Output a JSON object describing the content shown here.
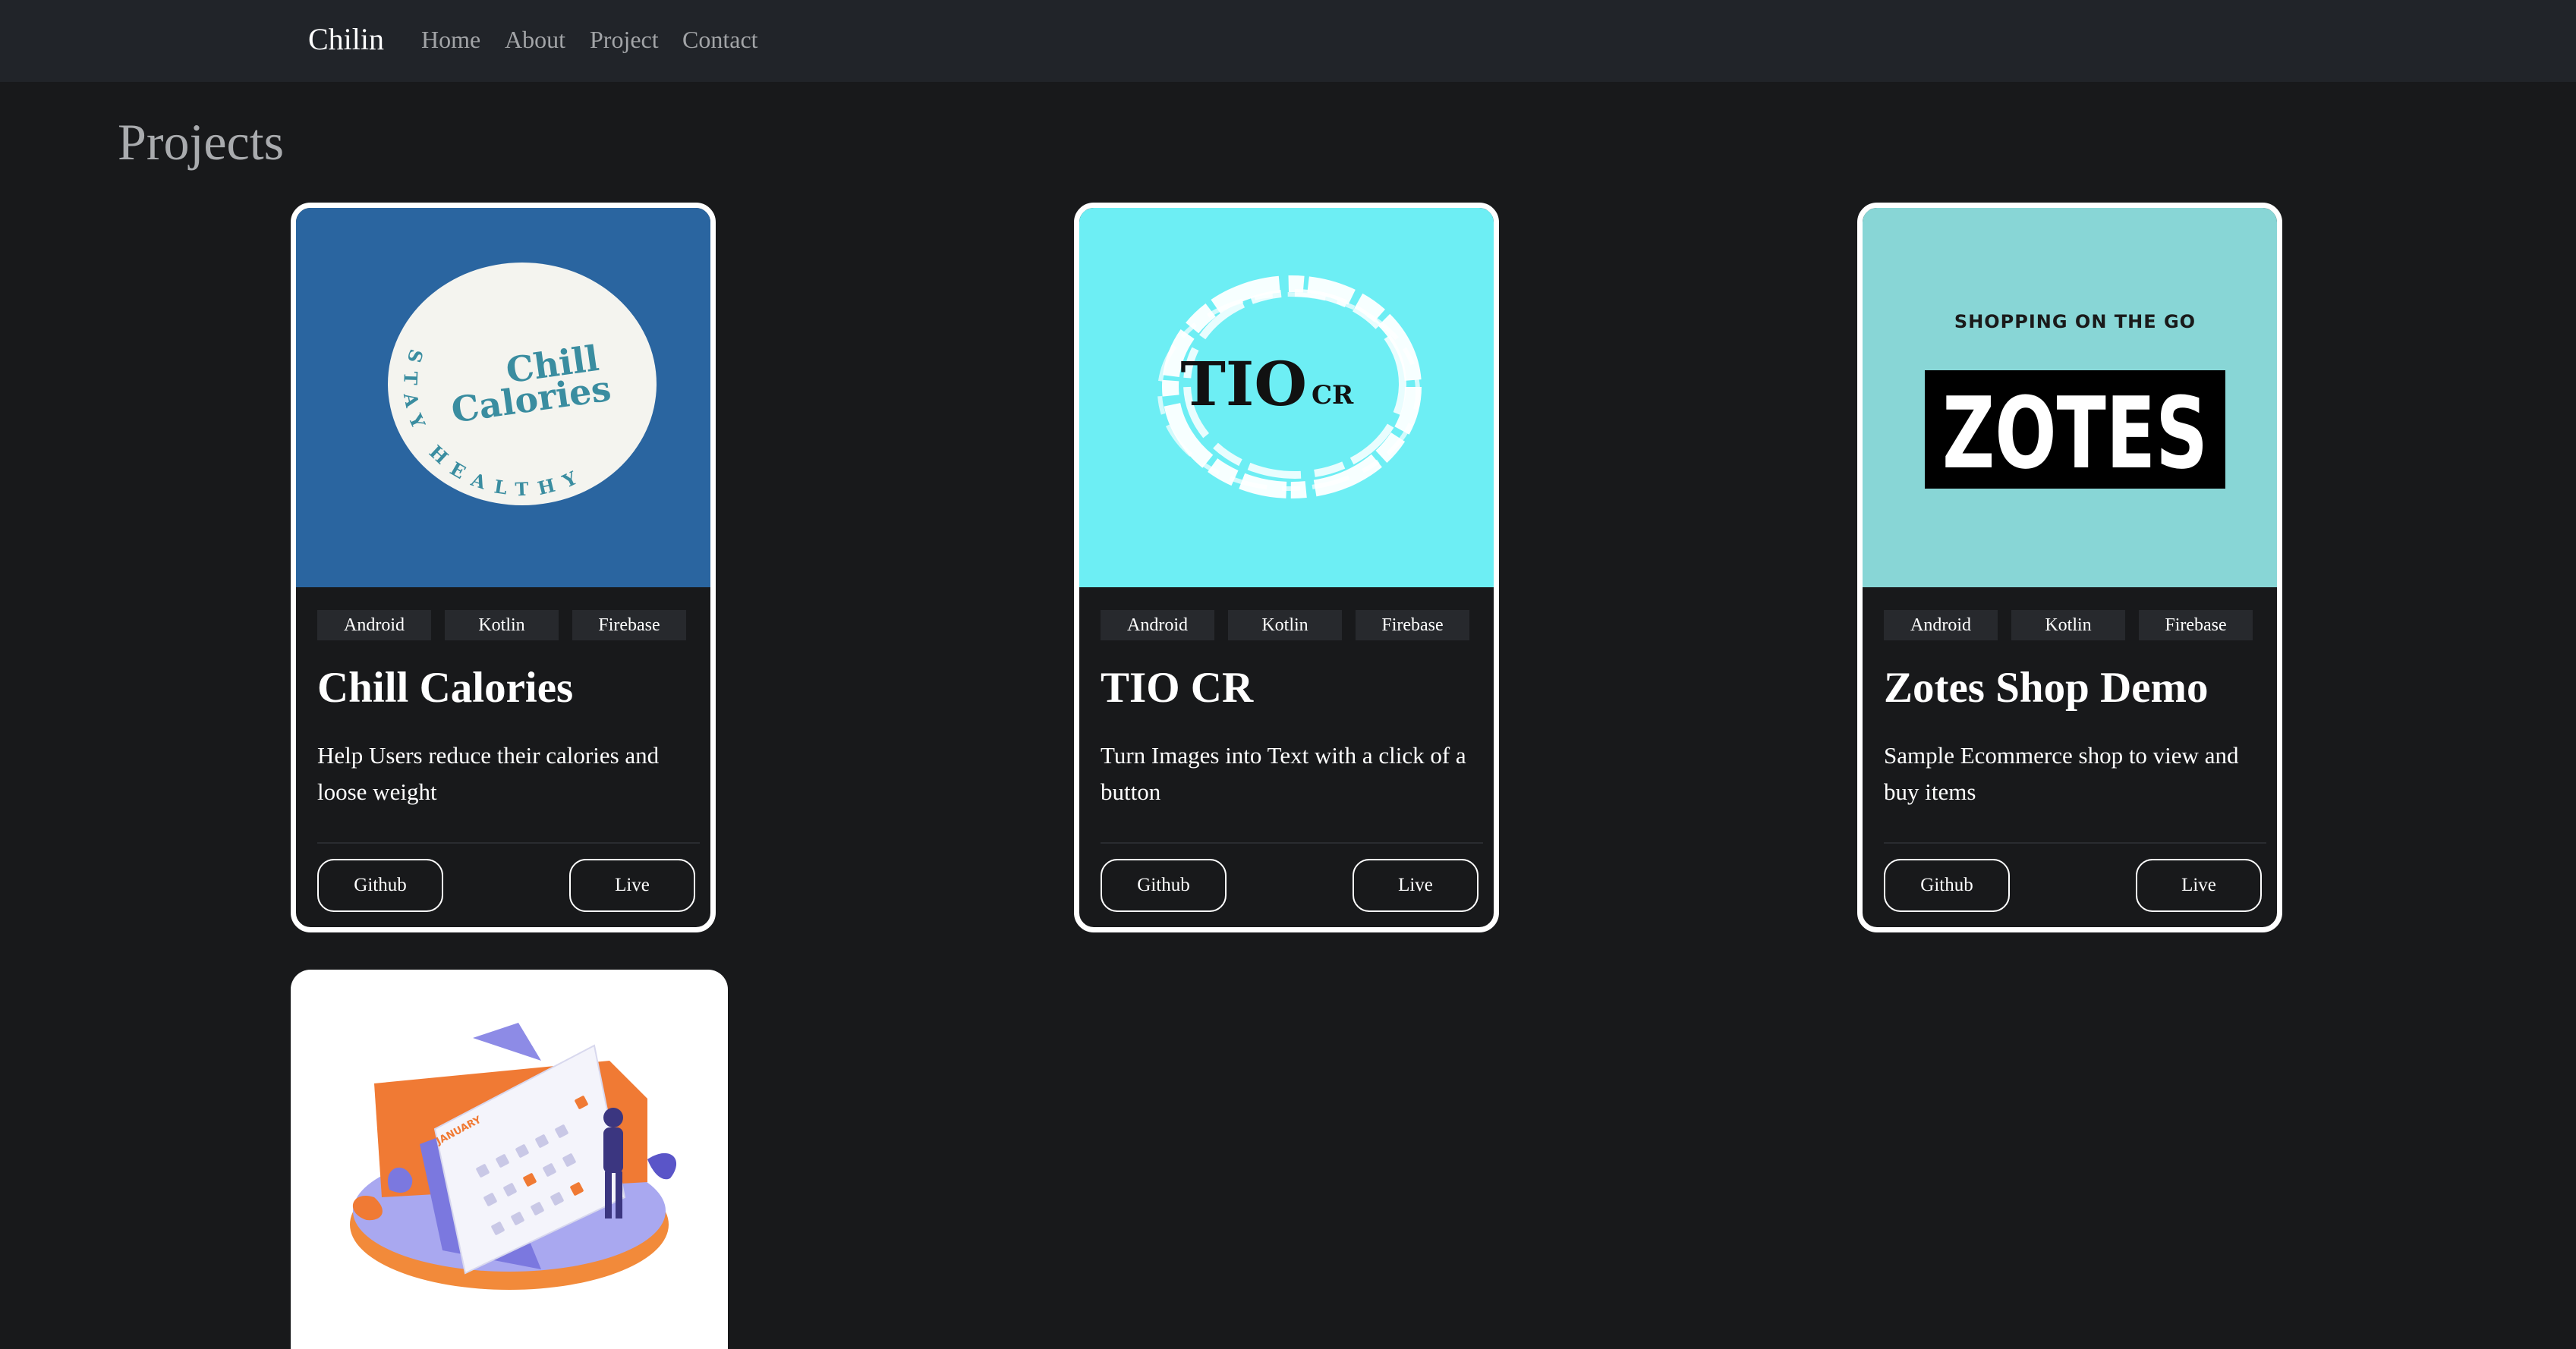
{
  "nav": {
    "brand": "Chilin",
    "links": [
      "Home",
      "About",
      "Project",
      "Contact"
    ]
  },
  "page": {
    "title": "Projects"
  },
  "projects": [
    {
      "title": "Chill Calories",
      "description": "Help Users reduce their calories and loose weight",
      "tags": [
        "Android",
        "Kotlin",
        "Firebase"
      ],
      "github_label": "Github",
      "live_label": "Live",
      "image": {
        "bg_color": "#2a65a0",
        "logo_line1": "Chill",
        "logo_line2": "Calories",
        "logo_ring": "STAY HEALTHY"
      }
    },
    {
      "title": "TIO CR",
      "description": "Turn Images into Text with a click of a button",
      "tags": [
        "Android",
        "Kotlin",
        "Firebase"
      ],
      "github_label": "Github",
      "live_label": "Live",
      "image": {
        "bg_color": "#6deef4",
        "logo_main": "TIO",
        "logo_sub": "CR"
      }
    },
    {
      "title": "Zotes Shop Demo",
      "description": "Sample Ecommerce shop to view and buy items",
      "tags": [
        "Android",
        "Kotlin",
        "Firebase"
      ],
      "github_label": "Github",
      "live_label": "Live",
      "image": {
        "bg_color": "#88d6d6",
        "tagline": "SHOPPING ON THE GO",
        "logo": "ZOTES"
      }
    },
    {
      "image": {
        "bg_color": "#ffffff",
        "calendar_month": "JANUARY",
        "illustration": "calendar-illustration"
      }
    }
  ]
}
